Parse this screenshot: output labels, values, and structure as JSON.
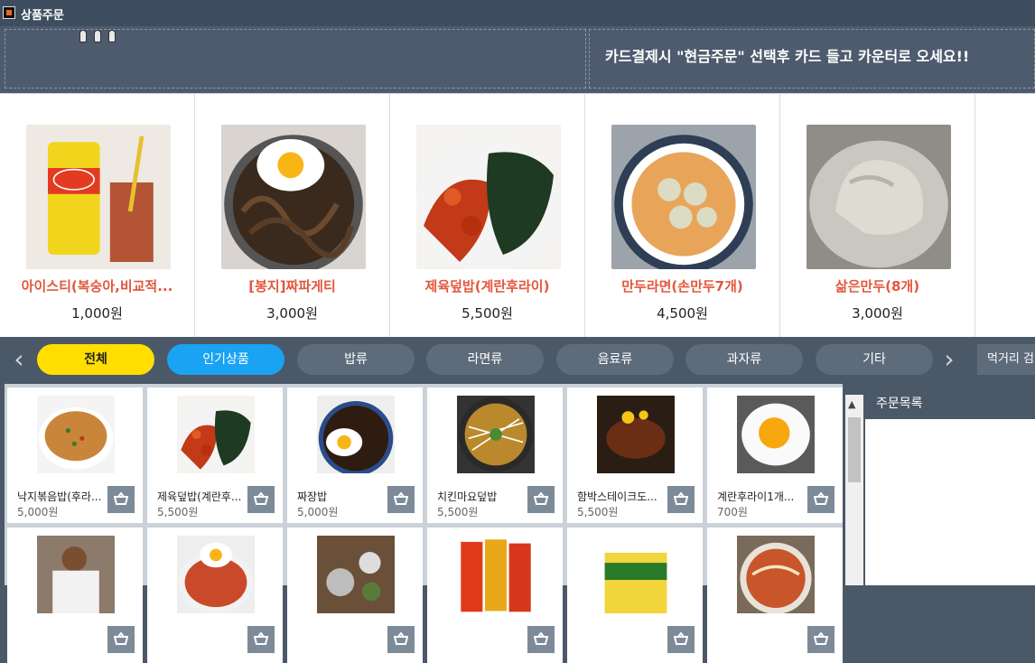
{
  "window": {
    "title": "상품주문",
    "app_icon": "app-icon"
  },
  "header": {
    "notice": "카드결제시 \"현금주문\" 선택후 카드 들고 카운터로 오세요!!"
  },
  "featured": [
    {
      "name": "아이스티(복숭아,비교적...",
      "price": "1,000원",
      "image": "iced-tea"
    },
    {
      "name": "[봉지]짜파게티",
      "price": "3,000원",
      "image": "jjapaghetti"
    },
    {
      "name": "제육덮밥(계란후라이)",
      "price": "5,500원",
      "image": "jeyuk"
    },
    {
      "name": "만두라면(손만두7개)",
      "price": "4,500원",
      "image": "mandu-ramen"
    },
    {
      "name": "삶은만두(8개)",
      "price": "3,000원",
      "image": "dumplings"
    }
  ],
  "categories": {
    "prev_icon": "chevron-left-icon",
    "next_icon": "chevron-right-icon",
    "items": [
      {
        "label": "전체",
        "state": "selected"
      },
      {
        "label": "인기상품",
        "state": "highlight"
      },
      {
        "label": "밥류",
        "state": "normal"
      },
      {
        "label": "라면류",
        "state": "normal"
      },
      {
        "label": "음료류",
        "state": "normal"
      },
      {
        "label": "과자류",
        "state": "normal"
      },
      {
        "label": "기타",
        "state": "normal"
      }
    ],
    "search_placeholder": "먹거리 검"
  },
  "products": [
    {
      "name": "낙지볶음밥(후라...",
      "price": "5,000원",
      "image": "fried-rice"
    },
    {
      "name": "제육덮밥(계란후...",
      "price": "5,500원",
      "image": "jeyuk"
    },
    {
      "name": "짜장밥",
      "price": "5,000원",
      "image": "jjajang"
    },
    {
      "name": "치킨마요덮밥",
      "price": "5,500원",
      "image": "chicken-mayo"
    },
    {
      "name": "함박스테이크도...",
      "price": "5,500원",
      "image": "hamburg"
    },
    {
      "name": "계란후라이1개...",
      "price": "700원",
      "image": "egg"
    },
    {
      "name": "",
      "price": "",
      "image": "person"
    },
    {
      "name": "",
      "price": "",
      "image": "egg-rice"
    },
    {
      "name": "",
      "price": "",
      "image": "table-set"
    },
    {
      "name": "",
      "price": "",
      "image": "snack-bags"
    },
    {
      "name": "",
      "price": "",
      "image": "ramen-pack"
    },
    {
      "name": "",
      "price": "",
      "image": "noodle-bowl"
    }
  ],
  "order_panel": {
    "title": "주문목록"
  },
  "colors": {
    "accent_yellow": "#ffde00",
    "accent_blue": "#1aa3f2",
    "price_red": "#e3573b",
    "header_bg": "#4b5868"
  }
}
